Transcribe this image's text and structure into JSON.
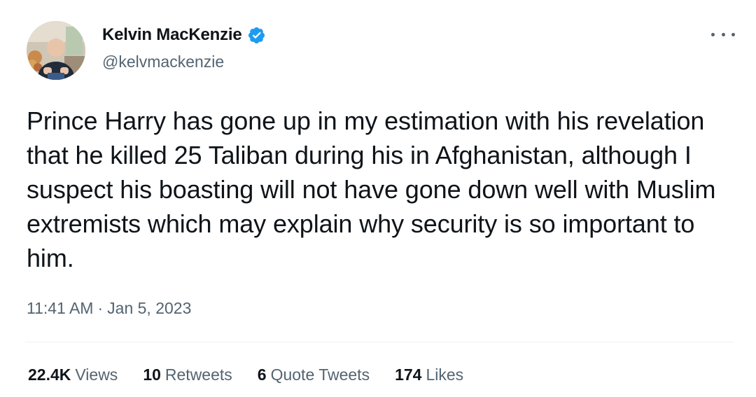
{
  "author": {
    "display_name": "Kelvin MacKenzie",
    "handle": "@kelvmackenzie",
    "verified_icon": "verified-badge-icon",
    "avatar_icon": "profile-photo"
  },
  "menu": {
    "icon": "more-options-icon"
  },
  "tweet": {
    "text": "Prince Harry has gone up in my estimation with his revelation that he killed 25 Taliban during his in Afghanistan, although I suspect his boasting will not have gone down well with Muslim extremists which may explain why security is so important to him.",
    "time": "11:41 AM",
    "separator": "·",
    "date": "Jan 5, 2023"
  },
  "stats": [
    {
      "value": "22.4K",
      "label": "Views"
    },
    {
      "value": "10",
      "label": "Retweets"
    },
    {
      "value": "6",
      "label": "Quote Tweets"
    },
    {
      "value": "174",
      "label": "Likes"
    }
  ],
  "colors": {
    "text_primary": "#0f1419",
    "text_secondary": "#536471",
    "verified_blue": "#1d9bf0",
    "divider": "#eff3f4"
  }
}
